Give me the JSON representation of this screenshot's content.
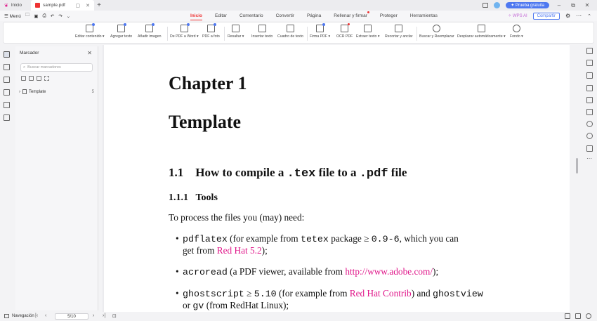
{
  "titlebar": {
    "tabs": [
      {
        "label": "Inicio"
      },
      {
        "label": "sample.pdf"
      }
    ],
    "trial_label": "Prueba gratuita"
  },
  "menubar": {
    "menu_label": "Menú",
    "tabs": [
      "Inicio",
      "Editar",
      "Comentario",
      "Convertir",
      "Página",
      "Rellenar y firmar",
      "Proteger",
      "Herramientas"
    ],
    "wps_ai": "WPS AI",
    "share": "Compartir"
  },
  "toolbar": {
    "tools": [
      "Editar contenido ▾",
      "Agregar texto",
      "Añadir imagen",
      "De PDF a Word ▾",
      "PDF a foto",
      "Resaltar ▾",
      "Insertar texto",
      "Cuadro de texto",
      "Firma PDF ▾",
      "OCR PDF",
      "Extraer texto ▾",
      "Recortar y anclar",
      "Buscar y Reemplazar",
      "Desplazar automáticamente ▾",
      "Fondo ▾"
    ]
  },
  "bookmarks": {
    "title": "Marcador",
    "search_placeholder": "Buscar marcadores",
    "items": [
      {
        "label": "Template",
        "count": "5"
      }
    ]
  },
  "document": {
    "chapter": "Chapter 1",
    "title": "Template",
    "section_num": "1.1",
    "section_a": "How to compile a ",
    "section_tex": ".tex",
    "section_b": " file to a ",
    "section_pdf": ".pdf",
    "section_c": " file",
    "subsection_num": "1.1.1",
    "subsection": "Tools",
    "intro": "To process the files you (may) need:",
    "bullet1": {
      "cmd": "pdflatex",
      "t1": " (for example from ",
      "pkg": "tetex",
      "t2": " package ≥ ",
      "ver": "0.9-6",
      "t3": ", which you can",
      "t4": "get from ",
      "link": "Red Hat 5.2",
      "t5": ");"
    },
    "bullet2": {
      "cmd": "acroread",
      "t1": " (a PDF viewer, available from ",
      "link": "http://www.adobe.com/",
      "t2": ");"
    },
    "bullet3": {
      "cmd": "ghostscript",
      "t1": " ≥ ",
      "ver": "5.10",
      "t2": " (for example from ",
      "link": "Red Hat Contrib",
      "t3": ") and ",
      "cmd2": "ghostview",
      "t4": "or ",
      "cmd3": "gv",
      "t5": " (from RedHat Linux);"
    }
  },
  "statusbar": {
    "navigation": "Navegación",
    "page": "5/10"
  }
}
